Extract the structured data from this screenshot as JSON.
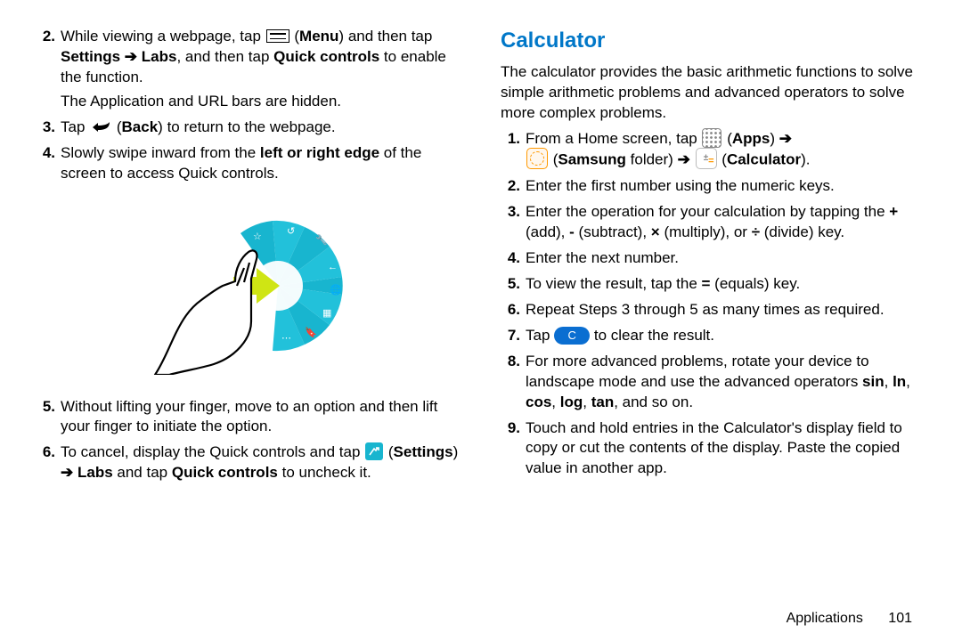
{
  "left": {
    "item2": {
      "num": "2.",
      "t1": "While viewing a webpage, tap ",
      "menu_label": "Menu",
      "t2": " and then tap ",
      "settings": "Settings",
      "arrow": "➔",
      "labs": "Labs",
      "t3": ", and then tap ",
      "quick": "Quick controls",
      "t4": " to enable the function.",
      "sub": "The Application and URL bars are hidden."
    },
    "item3": {
      "num": "3.",
      "t1": "Tap ",
      "back_label": "Back",
      "t2": " to return to the webpage."
    },
    "item4": {
      "num": "4.",
      "t1": "Slowly swipe inward from the ",
      "edge": "left or right edge",
      "t2": " of the screen to access Quick controls."
    },
    "item5": {
      "num": "5.",
      "t1": "Without lifting your finger, move to an option and then lift your finger to initiate the option."
    },
    "item6": {
      "num": "6.",
      "t1": "To cancel, display the Quick controls and tap ",
      "settings_label": "Settings",
      "arrow": "➔",
      "labs": "Labs",
      "t2": " and tap ",
      "quick": "Quick controls",
      "t3": " to uncheck it."
    }
  },
  "right": {
    "heading": "Calculator",
    "intro": "The calculator provides the basic arithmetic functions to solve simple arithmetic problems and advanced operators to solve more complex problems.",
    "item1": {
      "num": "1.",
      "t1": "From a Home screen, tap ",
      "apps": "Apps",
      "arrow": "➔",
      "samsung": "Samsung",
      "folder": " folder",
      "calc": "Calculator",
      "close": "."
    },
    "item2": {
      "num": "2.",
      "t": "Enter the first number using the numeric keys."
    },
    "item3": {
      "num": "3.",
      "t1": "Enter the operation for your calculation by tapping the ",
      "add": "+",
      "addw": " (add), ",
      "sub": "-",
      "subw": " (subtract), ",
      "mul": "×",
      "mulw": " (multiply), or ",
      "div": "÷",
      "divw": " (divide) key."
    },
    "item4": {
      "num": "4.",
      "t": "Enter the next number."
    },
    "item5": {
      "num": "5.",
      "t1": "To view the result, tap the ",
      "eq": "=",
      "t2": " (equals) key."
    },
    "item6": {
      "num": "6.",
      "t": "Repeat Steps 3 through 5 as many times as required."
    },
    "item7": {
      "num": "7.",
      "t1": "Tap ",
      "c": "C",
      "t2": " to clear the result."
    },
    "item8": {
      "num": "8.",
      "t1": "For more advanced problems, rotate your device to landscape mode and use the advanced operators ",
      "sin": "sin",
      "c1": ", ",
      "ln": "ln",
      "c2": ", ",
      "cos": "cos",
      "c3": ", ",
      "log": "log",
      "c4": ", ",
      "tan": "tan",
      "t2": ", and so on."
    },
    "item9": {
      "num": "9.",
      "t": "Touch and hold entries in the Calculator's display field to copy or cut the contents of the display. Paste the copied value in another app."
    }
  },
  "footer": {
    "section": "Applications",
    "page": "101"
  }
}
